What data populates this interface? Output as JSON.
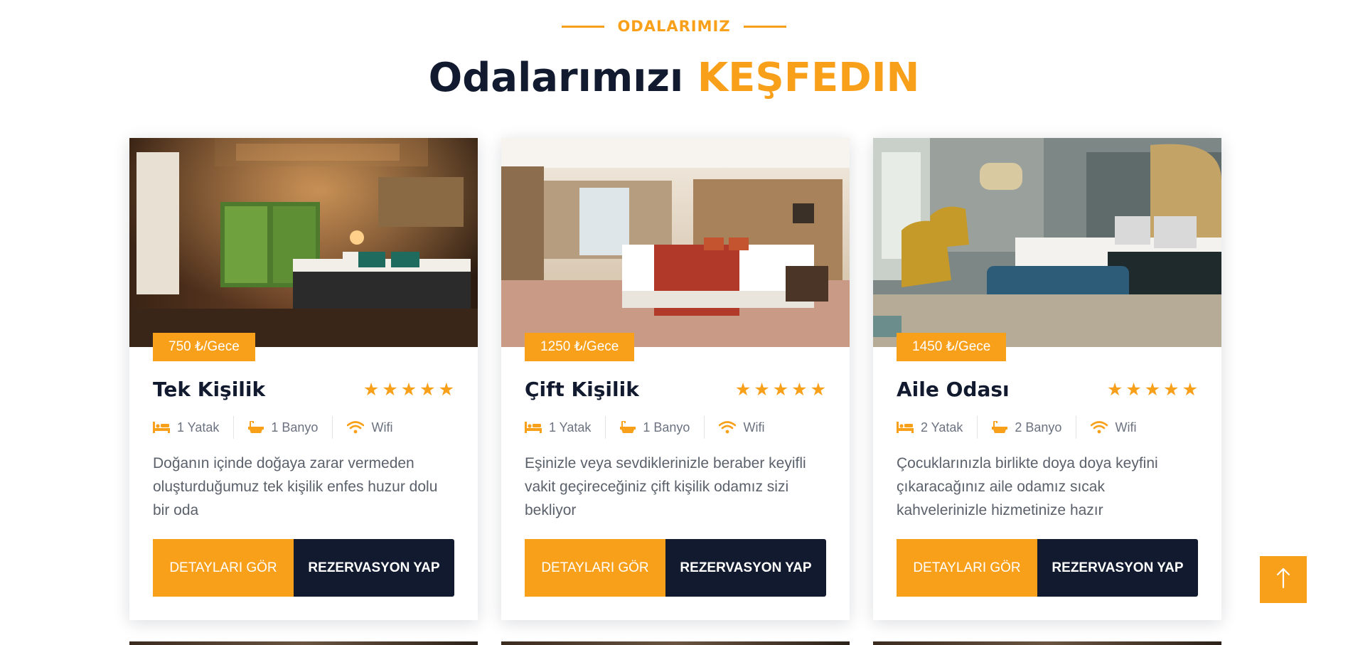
{
  "section": {
    "eyebrow": "ODALARIMIZ",
    "title_main": "Odalarımızı",
    "title_accent": "KEŞFEDIN"
  },
  "colors": {
    "accent": "#f9a01b",
    "dark": "#111a2e",
    "text": "#5b616b"
  },
  "rooms": [
    {
      "name": "Tek Kişilik",
      "price": "750 ₺/Gece",
      "rating": 5,
      "beds": "1 Yatak",
      "baths": "1 Banyo",
      "wifi": "Wifi",
      "description": "Doğanın içinde doğaya zarar vermeden oluşturduğumuz tek kişilik enfes huzur dolu bir oda",
      "details_label": "DETAYLARI GÖR",
      "reserve_label": "REZERVASYON YAP",
      "image_icon": "hotel-room-photo"
    },
    {
      "name": "Çift Kişilik",
      "price": "1250 ₺/Gece",
      "rating": 5,
      "beds": "1 Yatak",
      "baths": "1 Banyo",
      "wifi": "Wifi",
      "description": "Eşinizle veya sevdiklerinizle beraber keyifli vakit geçireceğiniz çift kişilik odamız sizi bekliyor",
      "details_label": "DETAYLARI GÖR",
      "reserve_label": "REZERVASYON YAP",
      "image_icon": "hotel-room-photo"
    },
    {
      "name": "Aile Odası",
      "price": "1450 ₺/Gece",
      "rating": 5,
      "beds": "2 Yatak",
      "baths": "2 Banyo",
      "wifi": "Wifi",
      "description": "Çocuklarınızla birlikte doya doya keyfini çıkaracağınız aile odamız sıcak kahvelerinizle hizmetinize hazır",
      "details_label": "DETAYLARI GÖR",
      "reserve_label": "REZERVASYON YAP",
      "image_icon": "hotel-room-photo"
    }
  ],
  "back_to_top_icon": "arrow-up-icon"
}
